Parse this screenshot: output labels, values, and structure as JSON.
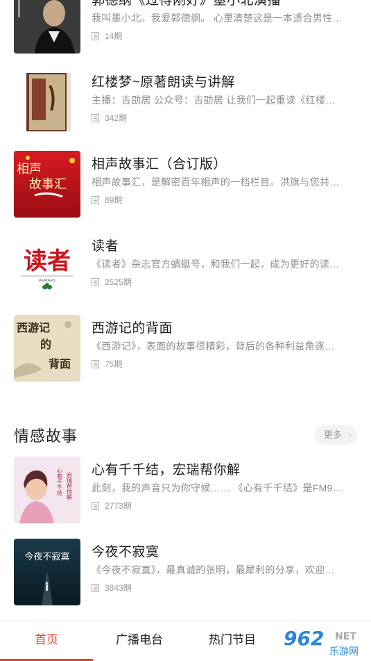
{
  "list_top": [
    {
      "title": "郭德纲《过得刚好》墨小北演播",
      "desc": "我叫墨小北。我爱郭德纲。 心里清楚这是一本适合男性…",
      "count": "14期",
      "cover": "portrait-cover"
    },
    {
      "title": "红楼梦~原著朗读与讲解",
      "desc": "主播：吉劭居 公众号：吉劭居 让我们一起重读《红楼…",
      "count": "342期",
      "cover": "book-cover"
    },
    {
      "title": "相声故事汇（合订版）",
      "desc": "相声故事汇，是解密百年相声的一档栏目。洪旗与您共…",
      "count": "89期",
      "cover": "red-calligraphy-cover"
    },
    {
      "title": "读者",
      "desc": "《读者》杂志官方蜻蜓号，和我们一起，成为更好的读…",
      "count": "2525期",
      "cover": "readers-logo-cover"
    },
    {
      "title": "西游记的背面",
      "desc": "《西游记》，表面的故事很精彩，背后的各种利益角逐…",
      "count": "75期",
      "cover": "ink-painting-cover"
    }
  ],
  "cover_texts": {
    "xiangsheng": "相声\n故事汇",
    "duzhe": "读者",
    "duzhe_sub": "READERS",
    "xiyouji_1": "西游记",
    "xiyouji_2": "的",
    "xiyouji_3": "背面",
    "xinyou": "心有千千结",
    "hongrui": "宏瑞帮你解",
    "jinye": "今夜不寂寞"
  },
  "section": {
    "title": "情感故事",
    "more_label": "更多",
    "more_chevron": "›"
  },
  "list_bottom": [
    {
      "title": "心有千千结，宏瑞帮你解",
      "desc": "此刻，我的声音只为你守候…… 《心有千千结》是FM9…",
      "count": "2773期",
      "cover": "woman-portrait-cover"
    },
    {
      "title": "今夜不寂寞",
      "desc": "《今夜不寂寞》，最真诚的张明，最犀利的分享，欢迎…",
      "count": "3843期",
      "cover": "night-road-cover"
    }
  ],
  "tabs": [
    {
      "label": "首页",
      "active": true
    },
    {
      "label": "广播电台",
      "active": false
    },
    {
      "label": "热门节目",
      "active": false
    },
    {
      "label": "",
      "active": false
    }
  ],
  "watermark": {
    "text": "962",
    "sub": "乐游网",
    "net": "NET"
  },
  "colors": {
    "accent": "#e0432d",
    "title": "#1c1c1c",
    "desc": "#8e8e8e",
    "count": "#999999"
  }
}
